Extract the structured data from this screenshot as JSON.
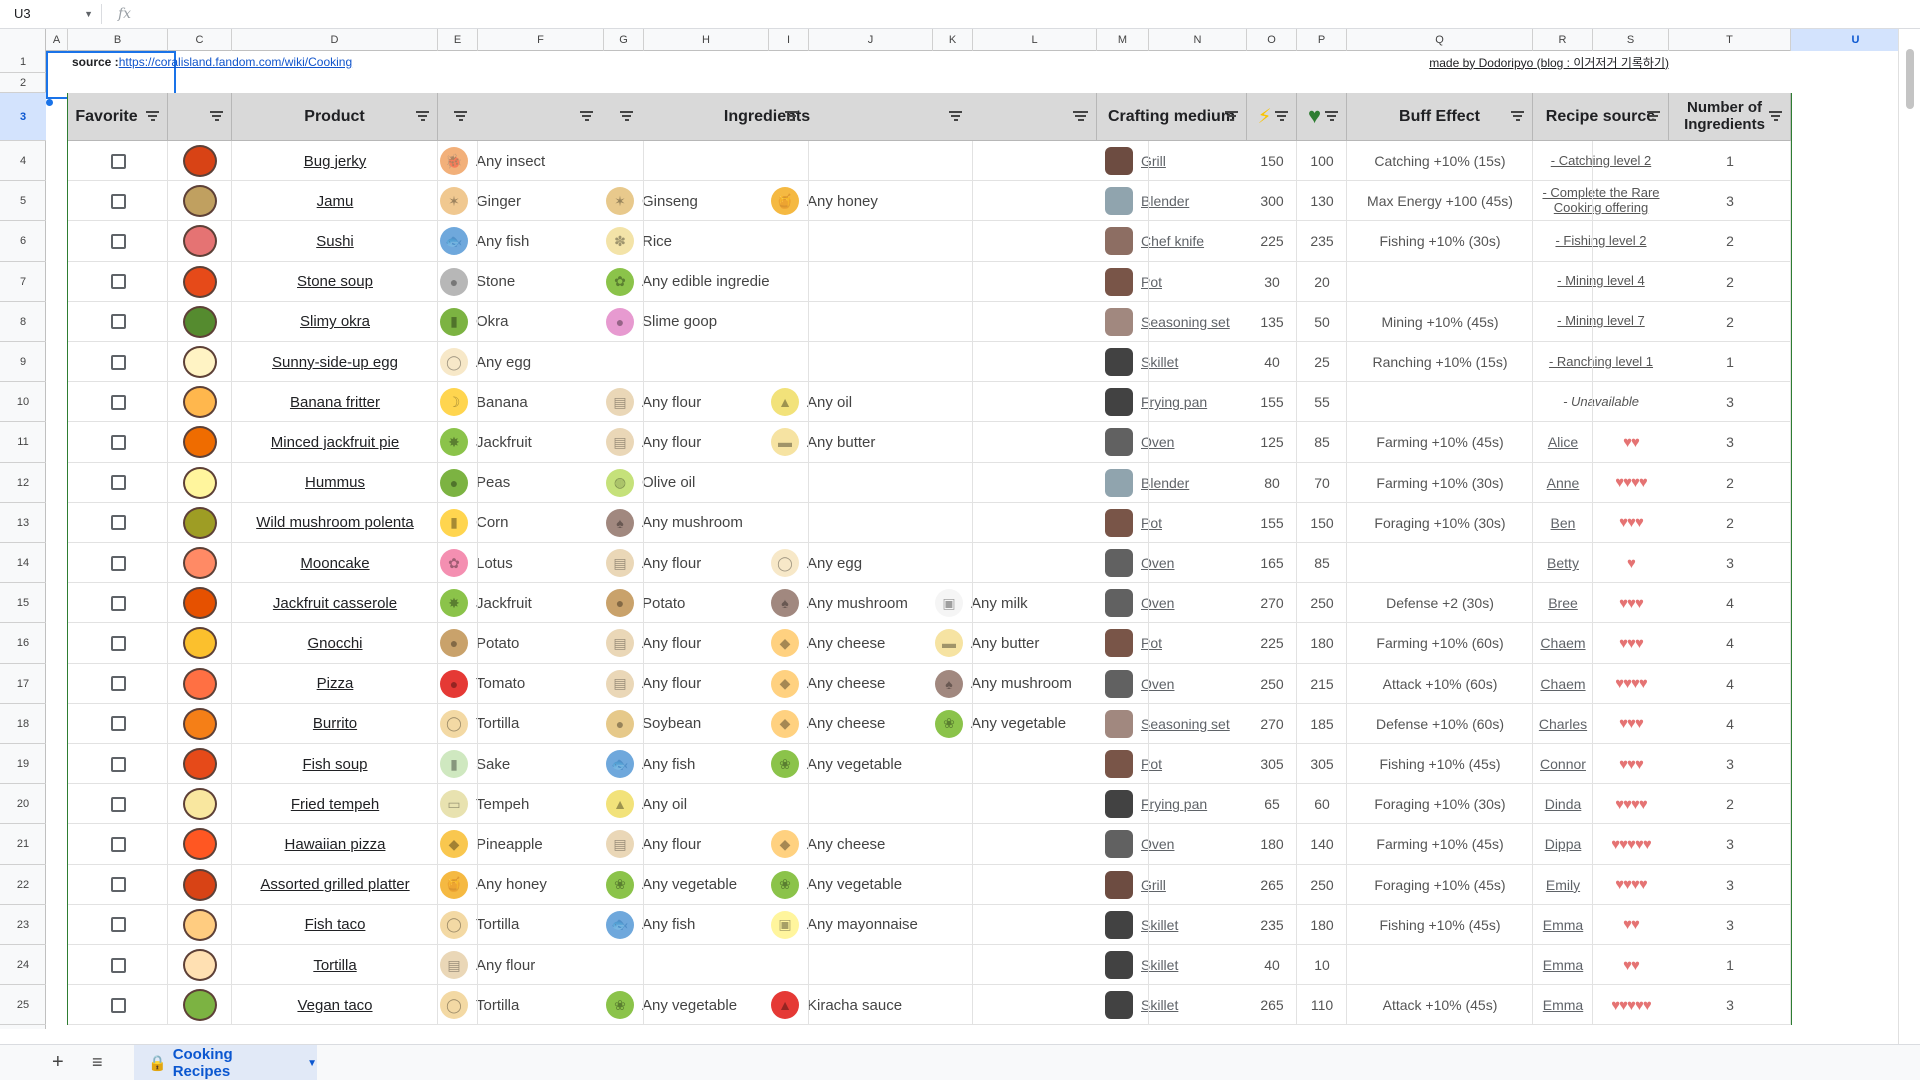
{
  "formula_bar": {
    "cell_ref": "U3",
    "fx": "fx"
  },
  "columns": [
    "A",
    "B",
    "C",
    "D",
    "E",
    "F",
    "G",
    "H",
    "I",
    "J",
    "K",
    "L",
    "M",
    "N",
    "O",
    "P",
    "Q",
    "R",
    "S",
    "T",
    "U"
  ],
  "selected_column": "U",
  "selected_row": "3",
  "rows": [
    "1",
    "2",
    "3",
    "4",
    "5",
    "6",
    "7",
    "8",
    "9",
    "10",
    "11",
    "12",
    "13",
    "14",
    "15",
    "16",
    "17",
    "18",
    "19",
    "20",
    "21",
    "22",
    "23",
    "24",
    "25"
  ],
  "source_label": "source : ",
  "source_url": "https://coralisland.fandom.com/wiki/Cooking",
  "made_by": "made by Dodoripyo (blog : 이거저거 기록하기)",
  "headers": {
    "favorite": "Favorite",
    "product": "Product",
    "ingredients": "Ingredients",
    "crafting_medium": "Crafting medium",
    "energy_icon": "lightning-icon",
    "health_icon": "heart-icon",
    "buff_effect": "Buff Effect",
    "recipe_source": "Recipe source",
    "number_of_ingredients": "Number of Ingredients"
  },
  "recipes": [
    {
      "product": "Bug jerky",
      "ingredients": [
        "Any insect"
      ],
      "medium": "Grill",
      "energy": "150",
      "health": "100",
      "buff": "Catching +10% (15s)",
      "source": "- Catching level 2",
      "hearts": "",
      "count": "1"
    },
    {
      "product": "Jamu",
      "ingredients": [
        "Ginger",
        "Ginseng",
        "Any honey"
      ],
      "medium": "Blender",
      "energy": "300",
      "health": "130",
      "buff": "Max Energy +100 (45s)",
      "source": "- Complete the Rare Cooking offering",
      "hearts": "",
      "count": "3"
    },
    {
      "product": "Sushi",
      "ingredients": [
        "Any fish",
        "Rice"
      ],
      "medium": "Chef knife",
      "energy": "225",
      "health": "235",
      "buff": "Fishing +10% (30s)",
      "source": "- Fishing level 2",
      "hearts": "",
      "count": "2"
    },
    {
      "product": "Stone soup",
      "ingredients": [
        "Stone",
        "Any edible ingredient"
      ],
      "medium": "Pot",
      "energy": "30",
      "health": "20",
      "buff": "",
      "source": "- Mining level 4",
      "hearts": "",
      "count": "2"
    },
    {
      "product": "Slimy okra",
      "ingredients": [
        "Okra",
        "Slime goop"
      ],
      "medium": "Seasoning set",
      "energy": "135",
      "health": "50",
      "buff": "Mining +10% (45s)",
      "source": "- Mining level 7",
      "hearts": "",
      "count": "2"
    },
    {
      "product": "Sunny-side-up egg",
      "ingredients": [
        "Any egg"
      ],
      "medium": "Skillet",
      "energy": "40",
      "health": "25",
      "buff": "Ranching +10% (15s)",
      "source": "- Ranching level 1",
      "hearts": "",
      "count": "1"
    },
    {
      "product": "Banana fritter",
      "ingredients": [
        "Banana",
        "Any flour",
        "Any oil"
      ],
      "medium": "Frying pan",
      "energy": "155",
      "health": "55",
      "buff": "",
      "source": "- Unavailable",
      "hearts": "",
      "count": "3"
    },
    {
      "product": "Minced jackfruit pie",
      "ingredients": [
        "Jackfruit",
        "Any flour",
        "Any butter"
      ],
      "medium": "Oven",
      "energy": "125",
      "health": "85",
      "buff": "Farming +10% (45s)",
      "source": "Alice",
      "hearts": "♥♥",
      "count": "3"
    },
    {
      "product": "Hummus",
      "ingredients": [
        "Peas",
        "Olive oil"
      ],
      "medium": "Blender",
      "energy": "80",
      "health": "70",
      "buff": "Farming +10% (30s)",
      "source": "Anne",
      "hearts": "♥♥♥♥",
      "count": "2"
    },
    {
      "product": "Wild mushroom polenta",
      "ingredients": [
        "Corn",
        "Any mushroom"
      ],
      "medium": "Pot",
      "energy": "155",
      "health": "150",
      "buff": "Foraging +10% (30s)",
      "source": "Ben",
      "hearts": "♥♥♥",
      "count": "2"
    },
    {
      "product": "Mooncake",
      "ingredients": [
        "Lotus",
        "Any flour",
        "Any egg"
      ],
      "medium": "Oven",
      "energy": "165",
      "health": "85",
      "buff": "",
      "source": "Betty",
      "hearts": "♥",
      "count": "3"
    },
    {
      "product": "Jackfruit casserole",
      "ingredients": [
        "Jackfruit",
        "Potato",
        "Any mushroom",
        "Any milk"
      ],
      "medium": "Oven",
      "energy": "270",
      "health": "250",
      "buff": "Defense +2 (30s)",
      "source": "Bree",
      "hearts": "♥♥♥",
      "count": "4"
    },
    {
      "product": "Gnocchi",
      "ingredients": [
        "Potato",
        "Any flour",
        "Any cheese",
        "Any butter"
      ],
      "medium": "Pot",
      "energy": "225",
      "health": "180",
      "buff": "Farming +10% (60s)",
      "source": "Chaem",
      "hearts": "♥♥♥",
      "count": "4"
    },
    {
      "product": "Pizza",
      "ingredients": [
        "Tomato",
        "Any flour",
        "Any cheese",
        "Any mushroom"
      ],
      "medium": "Oven",
      "energy": "250",
      "health": "215",
      "buff": "Attack +10% (60s)",
      "source": "Chaem",
      "hearts": "♥♥♥♥",
      "count": "4"
    },
    {
      "product": "Burrito",
      "ingredients": [
        "Tortilla",
        "Soybean",
        "Any cheese",
        "Any vegetable"
      ],
      "medium": "Seasoning set",
      "energy": "270",
      "health": "185",
      "buff": "Defense +10% (60s)",
      "source": "Charles",
      "hearts": "♥♥♥",
      "count": "4"
    },
    {
      "product": "Fish soup",
      "ingredients": [
        "Sake",
        "Any fish",
        "Any vegetable"
      ],
      "medium": "Pot",
      "energy": "305",
      "health": "305",
      "buff": "Fishing +10% (45s)",
      "source": "Connor",
      "hearts": "♥♥♥",
      "count": "3"
    },
    {
      "product": "Fried tempeh",
      "ingredients": [
        "Tempeh",
        "Any oil"
      ],
      "medium": "Frying pan",
      "energy": "65",
      "health": "60",
      "buff": "Foraging +10% (30s)",
      "source": "Dinda",
      "hearts": "♥♥♥♥",
      "count": "2"
    },
    {
      "product": "Hawaiian pizza",
      "ingredients": [
        "Pineapple",
        "Any flour",
        "Any cheese"
      ],
      "medium": "Oven",
      "energy": "180",
      "health": "140",
      "buff": "Farming +10% (45s)",
      "source": "Dippa",
      "hearts": "♥♥♥♥♥",
      "count": "3"
    },
    {
      "product": "Assorted grilled platter",
      "ingredients": [
        "Any honey",
        "Any vegetable",
        "Any vegetable"
      ],
      "medium": "Grill",
      "energy": "265",
      "health": "250",
      "buff": "Foraging +10% (45s)",
      "source": "Emily",
      "hearts": "♥♥♥♥",
      "count": "3"
    },
    {
      "product": "Fish taco",
      "ingredients": [
        "Tortilla",
        "Any fish",
        "Any mayonnaise"
      ],
      "medium": "Skillet",
      "energy": "235",
      "health": "180",
      "buff": "Fishing +10% (45s)",
      "source": "Emma",
      "hearts": "♥♥",
      "count": "3"
    },
    {
      "product": "Tortilla",
      "ingredients": [
        "Any flour"
      ],
      "medium": "Skillet",
      "energy": "40",
      "health": "10",
      "buff": "",
      "source": "Emma",
      "hearts": "♥♥",
      "count": "1"
    },
    {
      "product": "Vegan taco",
      "ingredients": [
        "Tortilla",
        "Any vegetable",
        "Kiracha sauce"
      ],
      "medium": "Skillet",
      "energy": "265",
      "health": "110",
      "buff": "Attack +10% (45s)",
      "source": "Emma",
      "hearts": "♥♥♥♥♥",
      "count": "3"
    }
  ],
  "sheet_tab": {
    "name": "Cooking Recipes"
  },
  "colors": {
    "header_bg": "#d9d9d9",
    "selection": "#1a73e8",
    "heart": "#e57373",
    "tab_bg": "#e1e9f7"
  }
}
